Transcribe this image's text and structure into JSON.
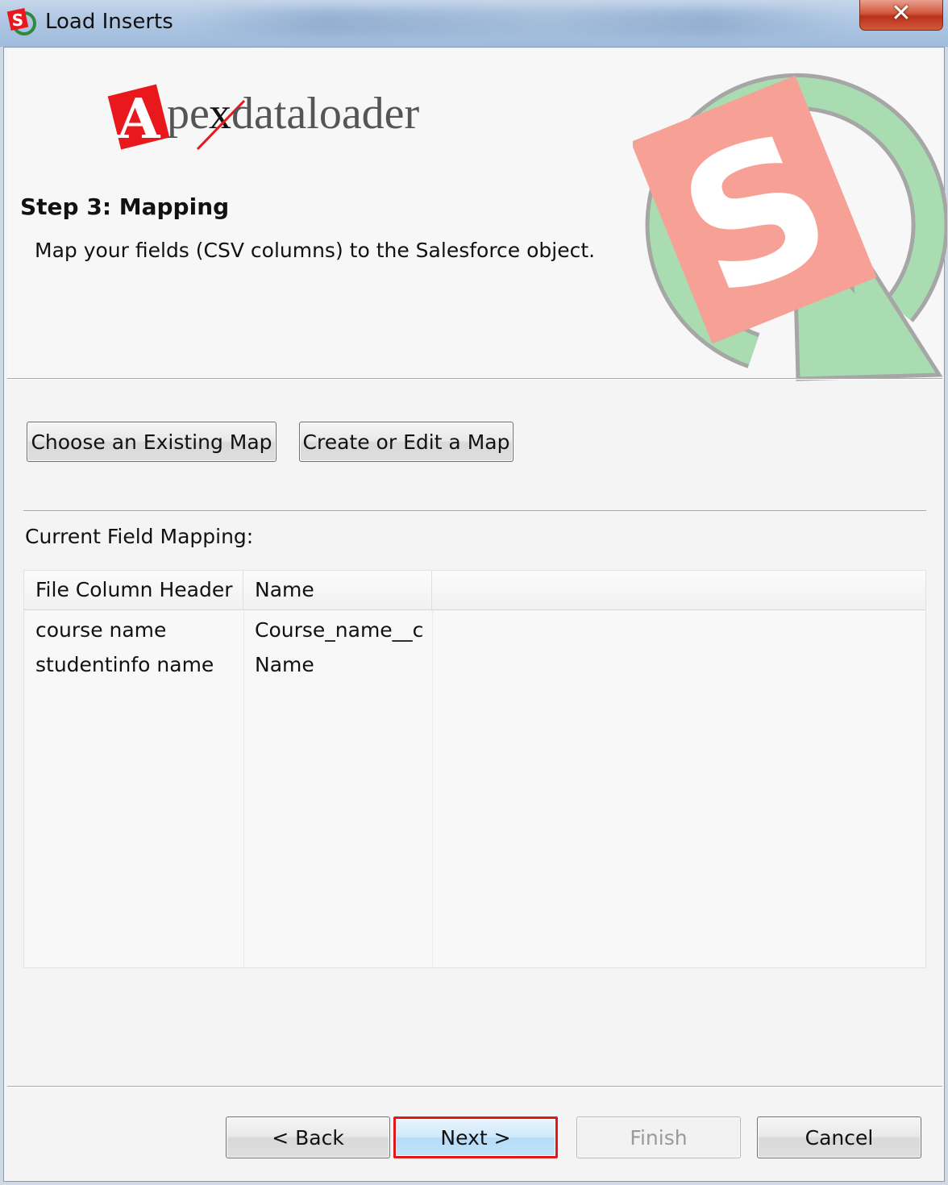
{
  "window": {
    "title": "Load Inserts",
    "close_glyph": "✕"
  },
  "header": {
    "logo_text": "Apexdataloader",
    "step_title": "Step 3: Mapping",
    "step_description": "Map your fields (CSV columns) to the Salesforce object."
  },
  "actions": {
    "choose_existing_map": "Choose an Existing Map",
    "create_or_edit_map": "Create or Edit a Map"
  },
  "mapping": {
    "label": "Current Field Mapping:",
    "columns": [
      "File Column Header",
      "Name"
    ],
    "rows": [
      [
        "course name",
        "Course_name__c"
      ],
      [
        "studentinfo name",
        "Name"
      ]
    ]
  },
  "footer": {
    "back": "< Back",
    "next": "Next >",
    "finish": "Finish",
    "cancel": "Cancel"
  },
  "colors": {
    "title_bar": "#aec6e3",
    "close_button": "#d2573c",
    "next_highlight": "#e01818",
    "logo_red": "#e8181c",
    "watermark_red": "#f7a096",
    "watermark_green": "#a9dcb0"
  },
  "icons": {
    "app": "apex-s-logo-icon",
    "close": "close-icon"
  }
}
